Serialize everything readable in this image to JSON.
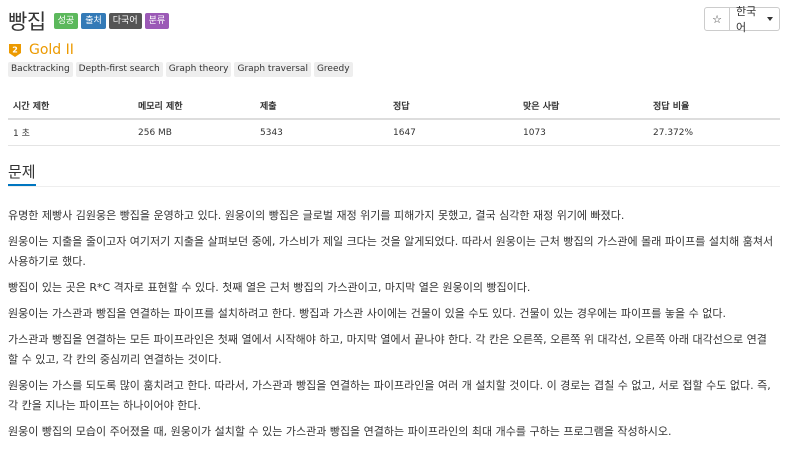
{
  "problem": {
    "title": "빵집",
    "badges": {
      "success": "성공",
      "judge": "출처",
      "lang": "다국어",
      "classify": "분류"
    },
    "tier": "Gold II",
    "tags": [
      "Backtracking",
      "Depth-first search",
      "Graph theory",
      "Graph traversal",
      "Greedy"
    ]
  },
  "controls": {
    "star": "☆",
    "language": "한국어"
  },
  "stats": {
    "headers": [
      "시간 제한",
      "메모리 제한",
      "제출",
      "정답",
      "맞은 사람",
      "정답 비율"
    ],
    "values": [
      "1 초",
      "256 MB",
      "5343",
      "1647",
      "1073",
      "27.372%"
    ]
  },
  "section": {
    "title": "문제"
  },
  "description": [
    "유명한 제빵사 김원웅은 빵집을 운영하고 있다. 원웅이의 빵집은 글로벌 재정 위기를 피해가지 못했고, 결국 심각한 재정 위기에 빠졌다.",
    "원웅이는 지출을 줄이고자 여기저기 지출을 살펴보던 중에, 가스비가 제일 크다는 것을 알게되었다. 따라서 원웅이는 근처 빵집의 가스관에 몰래 파이프를 설치해 훔쳐서 사용하기로 했다.",
    "빵집이 있는 곳은 R*C 격자로 표현할 수 있다. 첫째 열은 근처 빵집의 가스관이고, 마지막 열은 원웅이의 빵집이다.",
    "원웅이는 가스관과 빵집을 연결하는 파이프를 설치하려고 한다. 빵집과 가스관 사이에는 건물이 있을 수도 있다. 건물이 있는 경우에는 파이프를 놓을 수 없다.",
    "가스관과 빵집을 연결하는 모든 파이프라인은 첫째 열에서 시작해야 하고, 마지막 열에서 끝나야 한다. 각 칸은 오른쪽, 오른쪽 위 대각선, 오른쪽 아래 대각선으로 연결할 수 있고, 각 칸의 중심끼리 연결하는 것이다.",
    "원웅이는 가스를 되도록 많이 훔치려고 한다. 따라서, 가스관과 빵집을 연결하는 파이프라인을 여러 개 설치할 것이다. 이 경로는 겹칠 수 없고, 서로 접할 수도 없다. 즉, 각 칸을 지나는 파이프는 하나이어야 한다.",
    "원웅이 빵집의 모습이 주어졌을 때, 원웅이가 설치할 수 있는 가스관과 빵집을 연결하는 파이프라인의 최대 개수를 구하는 프로그램을 작성하시오."
  ],
  "colors": {
    "tier_gold": "#ec9a00",
    "success": "#5cb85c",
    "judge": "#337ab7",
    "lang": "#555555",
    "classify": "#9b59b6",
    "accent": "#0076c0"
  },
  "icons": {
    "tier": "gold-tier-icon",
    "star": "star-icon"
  }
}
